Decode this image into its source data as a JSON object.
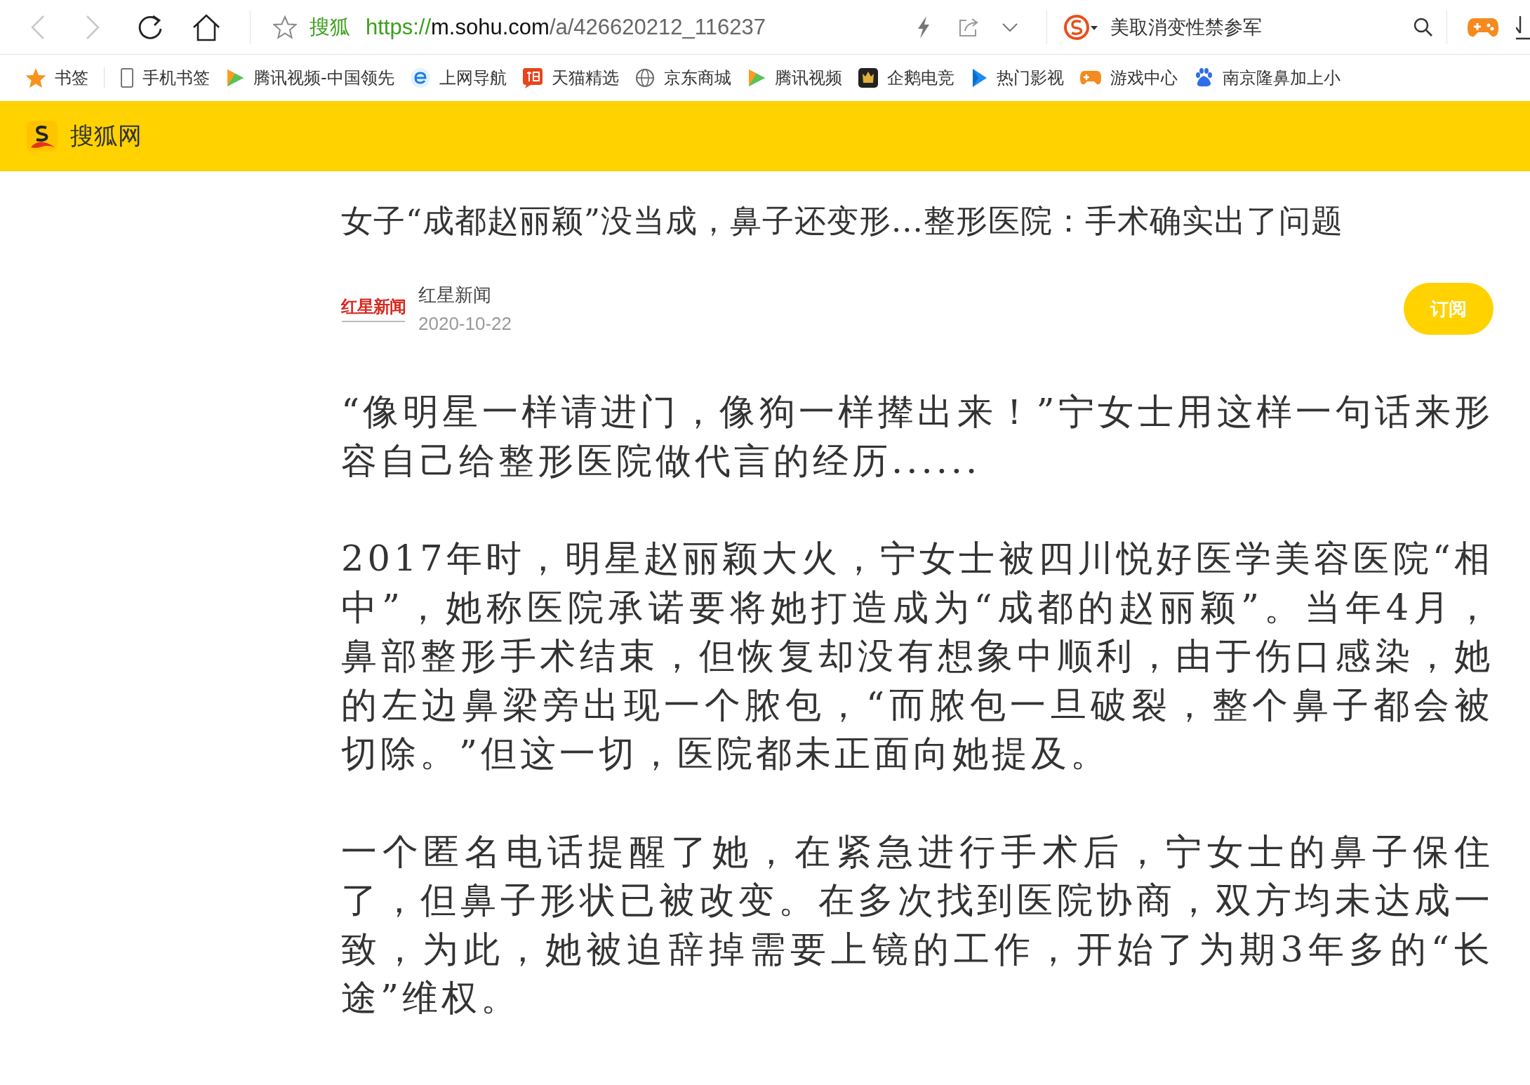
{
  "browser": {
    "back_disabled": true,
    "forward_disabled": true,
    "site_label": "搜狐",
    "url_scheme": "https://",
    "url_host": "m.sohu.com",
    "url_path": "/a/426620212_116237",
    "search_text": "美取消变性禁参军"
  },
  "bookmarks": [
    {
      "label": "书签",
      "kind": "star"
    },
    {
      "label": "手机书签",
      "kind": "phone"
    },
    {
      "label": "腾讯视频-中国领先",
      "kind": "video"
    },
    {
      "label": "上网导航",
      "kind": "ie"
    },
    {
      "label": "天猫精选",
      "kind": "tao"
    },
    {
      "label": "京东商城",
      "kind": "globe"
    },
    {
      "label": "腾讯视频",
      "kind": "video"
    },
    {
      "label": "企鹅电竞",
      "kind": "esports"
    },
    {
      "label": "热门影视",
      "kind": "play"
    },
    {
      "label": "游戏中心",
      "kind": "game"
    },
    {
      "label": "南京隆鼻加上小",
      "kind": "paw"
    }
  ],
  "site_header": {
    "title": "搜狐网"
  },
  "article": {
    "title": "女子“成都赵丽颖”没当成，鼻子还变形...整形医院：手术确实出了问题",
    "source_logo": "红星新闻",
    "source": "红星新闻",
    "date": "2020-10-22",
    "subscribe": "订阅",
    "paragraphs": [
      "“像明星一样请进门，像狗一样撵出来！”宁女士用这样一句话来形容自己给整形医院做代言的经历......",
      "2017年时，明星赵丽颖大火，宁女士被四川悦好医学美容医院“相中”，她称医院承诺要将她打造成为“成都的赵丽颖”。当年4月，鼻部整形手术结束，但恢复却没有想象中顺利，由于伤口感染，她的左边鼻梁旁出现一个脓包，“而脓包一旦破裂，整个鼻子都会被切除。”但这一切，医院都未正面向她提及。",
      "一个匿名电话提醒了她，在紧急进行手术后，宁女士的鼻子保住了，但鼻子形状已被改变。在多次找到医院协商，双方均未达成一致，为此，她被迫辞掉需要上镜的工作，开始了为期3年多的“长途”维权。"
    ]
  }
}
